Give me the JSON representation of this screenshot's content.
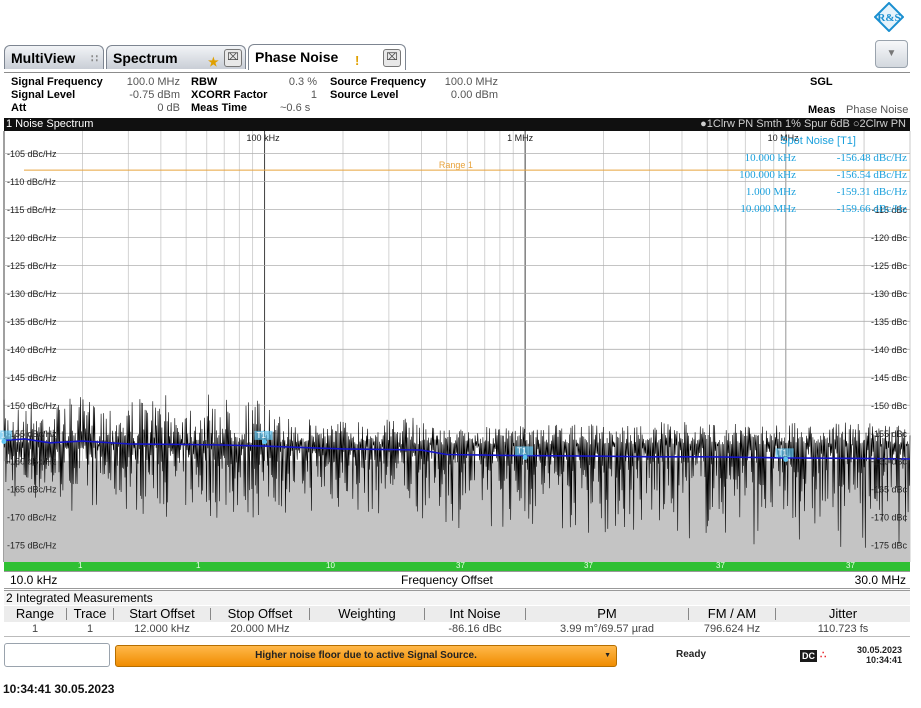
{
  "tabs": [
    {
      "label": "MultiView"
    },
    {
      "label": "Spectrum"
    },
    {
      "label": "Phase Noise"
    }
  ],
  "header": {
    "signal_frequency_label": "Signal Frequency",
    "signal_frequency_value": "100.0 MHz",
    "signal_level_label": "Signal Level",
    "signal_level_value": "-0.75 dBm",
    "att_label": "Att",
    "att_value": "0 dB",
    "rbw_label": "RBW",
    "rbw_value": "0.3 %",
    "xcorr_label": "XCORR Factor",
    "xcorr_value": "1",
    "meas_time_label": "Meas Time",
    "meas_time_value": "~0.6 s",
    "source_frequency_label": "Source Frequency",
    "source_frequency_value": "100.0 MHz",
    "source_level_label": "Source Level",
    "source_level_value": "0.00 dBm",
    "sgl": "SGL",
    "meas_label": "Meas",
    "meas_value": "Phase Noise"
  },
  "graph": {
    "title": "1 Noise Spectrum",
    "trace_info": "●1Clrw PN Smth 1% Spur 6dB ○2Clrw PN",
    "range_label": "Range 1"
  },
  "spot_noise": {
    "title": "Spot Noise [T1]",
    "rows": [
      {
        "offset": "10.000 kHz",
        "value": "-156.48 dBc/Hz"
      },
      {
        "offset": "100.000 kHz",
        "value": "-156.54 dBc/Hz"
      },
      {
        "offset": "1.000 MHz",
        "value": "-159.31 dBc/Hz"
      },
      {
        "offset": "10.000 MHz",
        "value": "-159.66 dBc/Hz"
      }
    ]
  },
  "axis": {
    "start": "10.0 kHz",
    "center_label": "Frequency Offset",
    "stop": "30.0 MHz"
  },
  "integrated": {
    "title": "2 Integrated Measurements",
    "columns": [
      "Range",
      "Trace",
      "Start Offset",
      "Stop Offset",
      "Weighting",
      "Int Noise",
      "PM",
      "FM / AM",
      "Jitter"
    ],
    "row": [
      "1",
      "1",
      "12.000 kHz",
      "20.000 MHz",
      "",
      "-86.16 dBc",
      "3.99 m°/69.57 µrad",
      "796.624 Hz",
      "110.723 fs"
    ]
  },
  "status": {
    "message": "Higher noise floor due to active Signal Source.",
    "ready": "Ready",
    "dc": "DC",
    "date": "30.05.2023",
    "time": "10:34:41"
  },
  "footer_timestamp": "10:34:41  30.05.2023",
  "colors": {
    "trace1": "#1414c8",
    "trace2": "#000000",
    "spot_text": "#1aa0dc",
    "range_line": "#e8a33c",
    "green_bar": "#2fc033",
    "status_orange": "#f39b12"
  },
  "chart_data": {
    "type": "line",
    "title": "1 Noise Spectrum",
    "xlabel": "Frequency Offset",
    "ylabel": "",
    "x_scale": "log",
    "xlim": [
      "10.0 kHz",
      "30.0 MHz"
    ],
    "ylim": [
      -178,
      -101
    ],
    "y_unit": "dBc/Hz",
    "x_tick_labels": [
      "100 kHz",
      "1 MHz",
      "10 MHz"
    ],
    "y_ticks_left": [
      "-105 dBc/Hz",
      "-110 dBc/Hz",
      "-115 dBc/Hz",
      "-120 dBc/Hz",
      "-125 dBc/Hz",
      "-130 dBc/Hz",
      "-135 dBc/Hz",
      "-140 dBc/Hz",
      "-145 dBc/Hz",
      "-150 dBc/Hz",
      "-155 dBc/Hz",
      "-160 dBc/Hz",
      "-165 dBc/Hz",
      "-170 dBc/Hz",
      "-175 dBc/Hz"
    ],
    "y_ticks_right": [
      "-115 dBc",
      "-120 dBc",
      "-125 dBc",
      "-130 dBc",
      "-135 dBc",
      "-140 dBc",
      "-145 dBc",
      "-150 dBc",
      "-155 dBc",
      "-160 dBc",
      "-165 dBc",
      "-170 dBc",
      "-175 dBc"
    ],
    "range_line_y": -108,
    "series": [
      {
        "name": "1Clrw PN Smth 1% Spur 6dB",
        "points": [
          [
            10000,
            -156.3
          ],
          [
            12000,
            -156.0
          ],
          [
            15000,
            -156.7
          ],
          [
            20000,
            -156.4
          ],
          [
            30000,
            -156.9
          ],
          [
            50000,
            -157.0
          ],
          [
            70000,
            -157.1
          ],
          [
            100000,
            -157.3
          ],
          [
            150000,
            -157.6
          ],
          [
            200000,
            -157.8
          ],
          [
            300000,
            -157.9
          ],
          [
            400000,
            -158.0
          ],
          [
            500000,
            -158.8
          ],
          [
            700000,
            -158.9
          ],
          [
            1000000,
            -159.0
          ],
          [
            2000000,
            -159.1
          ],
          [
            3000000,
            -159.2
          ],
          [
            5000000,
            -159.2
          ],
          [
            10000000,
            -159.4
          ],
          [
            20000000,
            -159.5
          ],
          [
            30000000,
            -159.6
          ]
        ]
      },
      {
        "name": "2Clrw PN",
        "envelope": [
          [
            10000,
            -149,
            -168
          ],
          [
            30000,
            -148,
            -170
          ],
          [
            100000,
            -148,
            -172
          ],
          [
            110000,
            -152,
            -170
          ],
          [
            400000,
            -152,
            -171
          ],
          [
            500000,
            -154,
            -172
          ],
          [
            3000000,
            -153,
            -175
          ],
          [
            30000000,
            -153,
            -176
          ]
        ]
      }
    ],
    "markers": [
      {
        "label": "T1",
        "x": 10000,
        "y": -156.48
      },
      {
        "label": "T1",
        "x": 100000,
        "y": -156.54
      },
      {
        "label": "T1",
        "x": 1000000,
        "y": -159.31
      },
      {
        "label": "T1",
        "x": 10000000,
        "y": -159.66
      }
    ],
    "range_segments": [
      "1",
      "1",
      "10",
      "37",
      "37",
      "37",
      "37"
    ]
  }
}
